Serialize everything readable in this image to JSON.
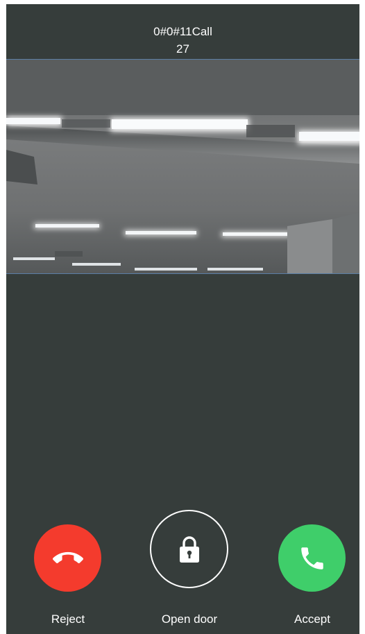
{
  "call": {
    "caller_id": "0#0#11Call",
    "elapsed": "27"
  },
  "video": {
    "icon": "camera-feed"
  },
  "actions": {
    "reject": {
      "label": "Reject",
      "icon": "hang-up-icon",
      "color": "#f43b2d"
    },
    "open_door": {
      "label": "Open door",
      "icon": "lock-icon",
      "color": "#ffffff"
    },
    "accept": {
      "label": "Accept",
      "icon": "phone-icon",
      "color": "#3fce6a"
    }
  },
  "colors": {
    "background": "#363d3b",
    "video_border": "#5b7fa6"
  }
}
